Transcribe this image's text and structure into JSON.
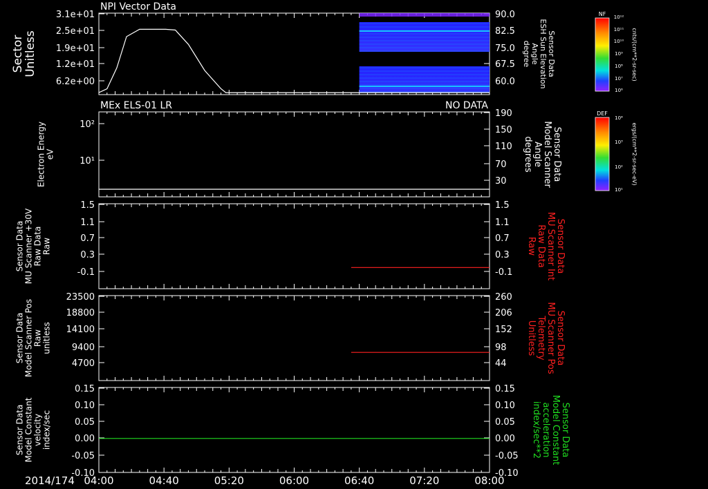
{
  "page": {
    "date_label": "2014/174"
  },
  "colors": {
    "background": "#000000",
    "axis": "#ffffff",
    "red_series": "#ff2020",
    "green_series": "#20dd20"
  },
  "time_axis": {
    "start": "04:00",
    "end": "08:00",
    "tick_labels": [
      "04:00",
      "04:40",
      "05:20",
      "06:00",
      "06:40",
      "07:20",
      "08:00"
    ]
  },
  "colorbars": [
    {
      "title": "NF",
      "label": "cnts/(cm**2-sr-sec)",
      "ticks": [
        "10¹²",
        "10¹¹",
        "10¹⁰",
        "10⁹",
        "10⁸",
        "10⁷",
        "10⁶"
      ]
    },
    {
      "title": "DEF",
      "label": "ergs/(cm**2-sr-sec-eV)",
      "ticks": [
        "10⁴",
        "10³",
        "10²",
        "10¹"
      ]
    }
  ],
  "chart_data": [
    {
      "type": "line",
      "title": "NPI Vector Data",
      "title_right": "",
      "ylabel_left": [
        "Sector",
        "Unitless"
      ],
      "ylabel_right": [
        "Sensor Data",
        "ESH Sun Elevation",
        "Angle",
        "degree"
      ],
      "yticks_left": [
        "3.1e+01",
        "2.5e+01",
        "1.9e+01",
        "1.2e+01",
        "6.2e+00"
      ],
      "yticks_right": [
        "90.0",
        "82.5",
        "75.0",
        "67.5",
        "60.0"
      ],
      "ylim": [
        0,
        31
      ],
      "series": [
        {
          "color": "#ffffff",
          "x": [
            "04:00",
            "04:05",
            "04:11",
            "04:17",
            "04:25",
            "04:41",
            "04:47",
            "04:55",
            "05:05",
            "05:15",
            "05:18",
            "06:40",
            "08:00"
          ],
          "values": [
            0.5,
            2,
            10,
            22,
            24.8,
            24.8,
            24.5,
            19,
            9,
            2,
            0.5,
            0.5,
            0.5
          ]
        }
      ],
      "spectrogram": {
        "start": "06:40",
        "end": "08:00",
        "colormap": "rainbow",
        "present": true
      }
    },
    {
      "type": "line",
      "title": "MEx ELS-01 LR",
      "title_right": "NO DATA",
      "ylabel_left": [
        "Electron Energy",
        "eV"
      ],
      "ylabel_right": [
        "Sensor Data",
        "Model Scanner",
        "Angle",
        "degrees"
      ],
      "yticks_left_major": [
        "10²",
        "10¹"
      ],
      "yticks_right": [
        "190",
        "150",
        "110",
        "70",
        "30"
      ],
      "ylim": [
        10,
        190
      ],
      "series": [
        {
          "color": "#ffffff",
          "x": [
            "04:00",
            "08:00"
          ],
          "values": [
            10,
            10
          ]
        }
      ]
    },
    {
      "type": "line",
      "title": "",
      "ylabel_left": [
        "Sensor Data",
        "MU Scanner +30V",
        "Raw Data",
        "Raw"
      ],
      "ylabel_right": [
        "Sensor Data",
        "MU Scanner Int",
        "Raw Data",
        "Raw"
      ],
      "ylabel_right_color": "#ff2020",
      "yticks_left": [
        "1.5",
        "1.1",
        "0.7",
        "0.3",
        "-0.1"
      ],
      "yticks_right": [
        "1.5",
        "1.1",
        "0.7",
        "0.3",
        "-0.1"
      ],
      "ylim": [
        -0.5,
        1.5
      ],
      "series": [
        {
          "color": "#ff2020",
          "x": [
            "06:35",
            "08:00"
          ],
          "values": [
            0,
            0
          ]
        }
      ]
    },
    {
      "type": "line",
      "title": "",
      "ylabel_left": [
        "Sensor Data",
        "Model Scanner Pos",
        "Raw",
        "unitless"
      ],
      "ylabel_right": [
        "Sensor Data",
        "MU Scanner Pos",
        "Telemetry",
        "Unitless"
      ],
      "ylabel_right_color": "#ff2020",
      "yticks_left": [
        "23500",
        "18800",
        "14100",
        "9400",
        "4700"
      ],
      "yticks_right": [
        "260",
        "206",
        "152",
        "98",
        "44"
      ],
      "ylim": [
        0,
        23500
      ],
      "series": [
        {
          "color": "#ff2020",
          "x": [
            "06:35",
            "08:00"
          ],
          "values": [
            7800,
            7800
          ]
        }
      ]
    },
    {
      "type": "line",
      "title": "",
      "ylabel_left": [
        "Sensor Data",
        "Model Constant",
        "velocity",
        "index/sec"
      ],
      "ylabel_right": [
        "Sensor Data",
        "Model Constant",
        "acceleration",
        "index/sec**2"
      ],
      "ylabel_right_color": "#20dd20",
      "yticks_left": [
        "0.15",
        "0.10",
        "0.05",
        "0.00",
        "-0.05",
        "-0.10"
      ],
      "yticks_right": [
        "0.15",
        "0.10",
        "0.05",
        "0.00",
        "-0.05",
        "-0.10"
      ],
      "ylim": [
        -0.1,
        0.15
      ],
      "series": [
        {
          "color": "#20dd20",
          "x": [
            "04:00",
            "08:00"
          ],
          "values": [
            0,
            0
          ]
        }
      ]
    }
  ]
}
